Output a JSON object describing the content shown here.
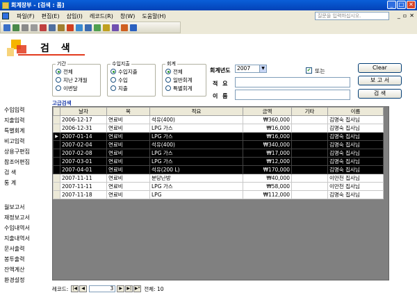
{
  "window": {
    "title": "회계장부 - [검색 : 폼]"
  },
  "menu": [
    "파일(F)",
    "편집(E)",
    "삽입(I)",
    "레코드(R)",
    "창(W)",
    "도움말(H)"
  ],
  "help_placeholder": "질문을 입력하십시오.",
  "page_title": "검 색",
  "sidebar": [
    "수입입력",
    "지출입력",
    "특별회계",
    "비고입력",
    "상용구편집",
    "참조어편집",
    "검 색",
    "통 계",
    "월보고서",
    "재정보고서",
    "수입내역서",
    "지출내역서",
    "문서출력",
    "봉투출력",
    "잔액계산",
    "환경설정"
  ],
  "filters": {
    "period": {
      "legend": "기간",
      "options": [
        "전체",
        "지난 2개월",
        "이번달"
      ],
      "selected": 0
    },
    "inout": {
      "legend": "수입지출",
      "options": [
        "수입지출",
        "수입",
        "지출"
      ],
      "selected": 0
    },
    "account": {
      "legend": "회계",
      "options": [
        "전체",
        "일반회계",
        "특별회계"
      ],
      "selected": 0
    }
  },
  "year": {
    "label": "회계년도",
    "value": "2007"
  },
  "or_label": "또는",
  "summary_label": "적 요",
  "name_label": "이 름",
  "buttons": {
    "clear": "Clear",
    "report": "보 고 서",
    "search": "검 색"
  },
  "advanced_label": "고급검색",
  "table": {
    "columns": [
      "날자",
      "목",
      "적요",
      "금액",
      "기타",
      "이름"
    ],
    "rows": [
      {
        "date": "2006-12-17",
        "item": "연료비",
        "desc": "석유(400)",
        "amount": "₩360,000",
        "etc": "",
        "name": "김명숙 집사님",
        "hl": false,
        "cur": false
      },
      {
        "date": "2006-12-31",
        "item": "연료비",
        "desc": "LPG 가스",
        "amount": "₩16,000",
        "etc": "",
        "name": "김명숙 집사님",
        "hl": false,
        "cur": false
      },
      {
        "date": "2007-01-14",
        "item": "연료비",
        "desc": "LPG 가스",
        "amount": "₩16,000",
        "etc": "",
        "name": "김명숙 집사님",
        "hl": true,
        "cur": true
      },
      {
        "date": "2007-02-04",
        "item": "연료비",
        "desc": "석유(400)",
        "amount": "₩340,000",
        "etc": "",
        "name": "김명숙 집사님",
        "hl": true,
        "cur": false
      },
      {
        "date": "2007-02-08",
        "item": "연료비",
        "desc": "LPG 가스",
        "amount": "₩17,000",
        "etc": "",
        "name": "김명숙 집사님",
        "hl": true,
        "cur": false
      },
      {
        "date": "2007-03-01",
        "item": "연료비",
        "desc": "LPG 가스",
        "amount": "₩12,000",
        "etc": "",
        "name": "김명숙 집사님",
        "hl": true,
        "cur": false
      },
      {
        "date": "2007-04-01",
        "item": "연료비",
        "desc": "석유(200 L)",
        "amount": "₩170,000",
        "etc": "",
        "name": "김명숙 집사님",
        "hl": true,
        "cur": false
      },
      {
        "date": "2007-11-11",
        "item": "연료비",
        "desc": "분당난방",
        "amount": "₩40,000",
        "etc": "",
        "name": "이만천 집사님",
        "hl": false,
        "cur": false
      },
      {
        "date": "2007-11-11",
        "item": "연료비",
        "desc": "LPG 가스",
        "amount": "₩58,000",
        "etc": "",
        "name": "이만천 집사님",
        "hl": false,
        "cur": false
      },
      {
        "date": "2007-11-18",
        "item": "연료비",
        "desc": "LPG",
        "amount": "₩112,000",
        "etc": "",
        "name": "김명숙 집사님",
        "hl": false,
        "cur": false
      }
    ]
  },
  "nav": {
    "label": "레코드:",
    "current": "3",
    "total": "전체: 10"
  }
}
